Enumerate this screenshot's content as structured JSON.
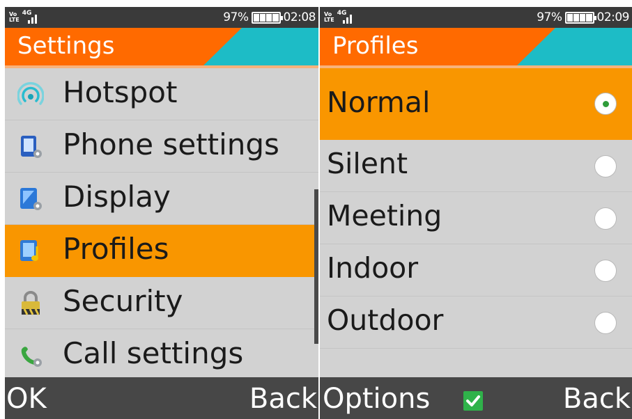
{
  "left_screen": {
    "status": {
      "network": "4G",
      "volte_top": "Vo",
      "volte_bottom": "LTE",
      "battery_pct": "97%",
      "time": "02:08"
    },
    "title": "Settings",
    "menu_items": [
      {
        "icon": "hotspot-icon",
        "label": "Hotspot"
      },
      {
        "icon": "phone-settings-icon",
        "label": "Phone settings"
      },
      {
        "icon": "display-icon",
        "label": "Display"
      },
      {
        "icon": "profiles-icon",
        "label": "Profiles",
        "selected": true
      },
      {
        "icon": "lock-icon",
        "label": "Security"
      },
      {
        "icon": "call-settings-icon",
        "label": "Call settings"
      }
    ],
    "softkeys": {
      "left": "OK",
      "right": "Back"
    }
  },
  "right_screen": {
    "status": {
      "network": "4G",
      "volte_top": "Vo",
      "volte_bottom": "LTE",
      "battery_pct": "97%",
      "time": "02:09"
    },
    "title": "Profiles",
    "profiles": [
      {
        "label": "Normal",
        "selected": true
      },
      {
        "label": "Silent",
        "selected": false
      },
      {
        "label": "Meeting",
        "selected": false
      },
      {
        "label": "Indoor",
        "selected": false
      },
      {
        "label": "Outdoor",
        "selected": false
      }
    ],
    "softkeys": {
      "left": "Options",
      "center_icon": "checkmark-icon",
      "right": "Back"
    }
  },
  "colors": {
    "title_orange": "#ff6a00",
    "title_cyan": "#1dbcc6",
    "selection": "#f99600",
    "list_bg": "#d2d2d2",
    "softkey_bar": "#474747",
    "radio_dot": "#2f9c3a",
    "check_green": "#2fb24a"
  }
}
